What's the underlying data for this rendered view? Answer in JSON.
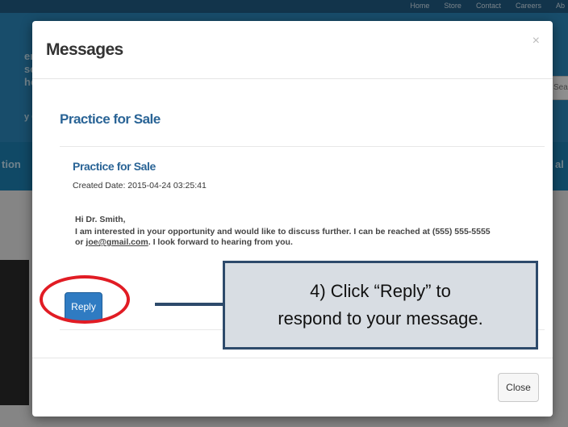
{
  "background": {
    "nav_items": [
      "Home",
      "Store",
      "Contact",
      "Careers",
      "Ab"
    ],
    "header_fragments": [
      "eric",
      "soci",
      "hod",
      "y Onl",
      "tion",
      "al"
    ],
    "search_placeholder": "Sea"
  },
  "modal": {
    "title": "Messages",
    "close_symbol": "×",
    "section_title": "Practice for Sale",
    "message": {
      "subject": "Practice for Sale",
      "created_date": "Created Date: 2015-04-24 03:25:41",
      "greeting": "Hi Dr. Smith,",
      "body_before_email": "I am interested in your opportunity and would like to discuss further. I can be reached at (555) 555-5555 or ",
      "email": "joe@gmail.com",
      "body_after_email": ". I look forward to hearing from you."
    },
    "reply_label": "Reply",
    "close_label": "Close"
  },
  "annotation": {
    "line1": "4) Click “Reply” to",
    "line2": "respond to your message.",
    "highlight_color": "#e11c24",
    "callout_border_color": "#2d4a6b"
  }
}
